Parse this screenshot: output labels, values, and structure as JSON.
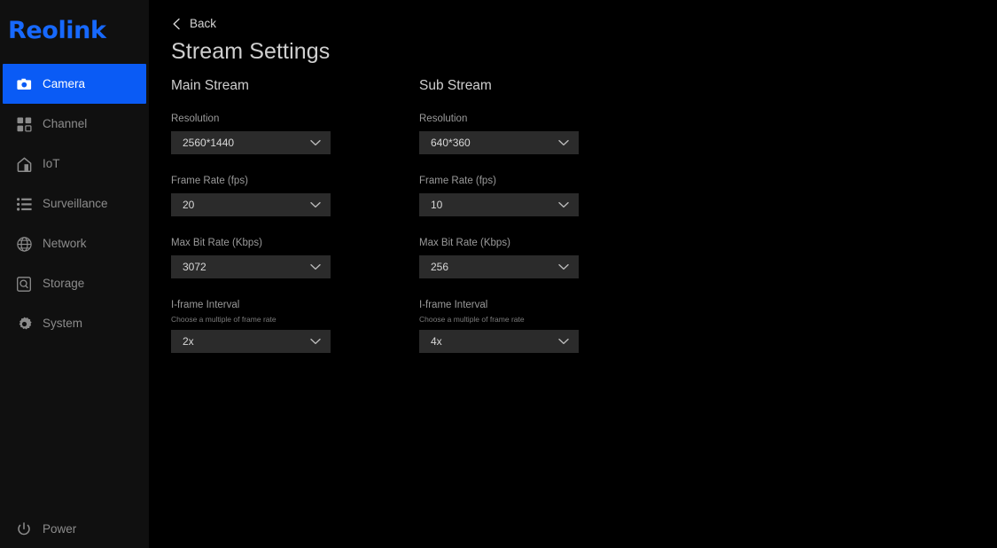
{
  "brand": {
    "name": "Reolink",
    "color": "#1769ff"
  },
  "sidebar": {
    "items": [
      {
        "label": "Camera",
        "icon": "camera-icon",
        "active": true
      },
      {
        "label": "Channel",
        "icon": "channel-grid-icon",
        "active": false
      },
      {
        "label": "IoT",
        "icon": "home-icon",
        "active": false
      },
      {
        "label": "Surveillance",
        "icon": "list-icon",
        "active": false
      },
      {
        "label": "Network",
        "icon": "globe-icon",
        "active": false
      },
      {
        "label": "Storage",
        "icon": "hard-drive-icon",
        "active": false
      },
      {
        "label": "System",
        "icon": "gear-icon",
        "active": false
      }
    ],
    "power": {
      "label": "Power",
      "icon": "power-icon"
    },
    "active_color": "#0a5bf5"
  },
  "header": {
    "back_label": "Back",
    "back_icon": "chevron-left-icon",
    "title": "Stream Settings"
  },
  "main_stream": {
    "heading": "Main Stream",
    "fields": [
      {
        "label": "Resolution",
        "hint": "",
        "value": "2560*1440"
      },
      {
        "label": "Frame Rate (fps)",
        "hint": "",
        "value": "20"
      },
      {
        "label": "Max Bit Rate (Kbps)",
        "hint": "",
        "value": "3072"
      },
      {
        "label": "I-frame Interval",
        "hint": "Choose a multiple of frame rate",
        "value": "2x"
      }
    ]
  },
  "sub_stream": {
    "heading": "Sub Stream",
    "fields": [
      {
        "label": "Resolution",
        "hint": "",
        "value": "640*360"
      },
      {
        "label": "Frame Rate (fps)",
        "hint": "",
        "value": "10"
      },
      {
        "label": "Max Bit Rate (Kbps)",
        "hint": "",
        "value": "256"
      },
      {
        "label": "I-frame Interval",
        "hint": "Choose a multiple of frame rate",
        "value": "4x"
      }
    ]
  }
}
